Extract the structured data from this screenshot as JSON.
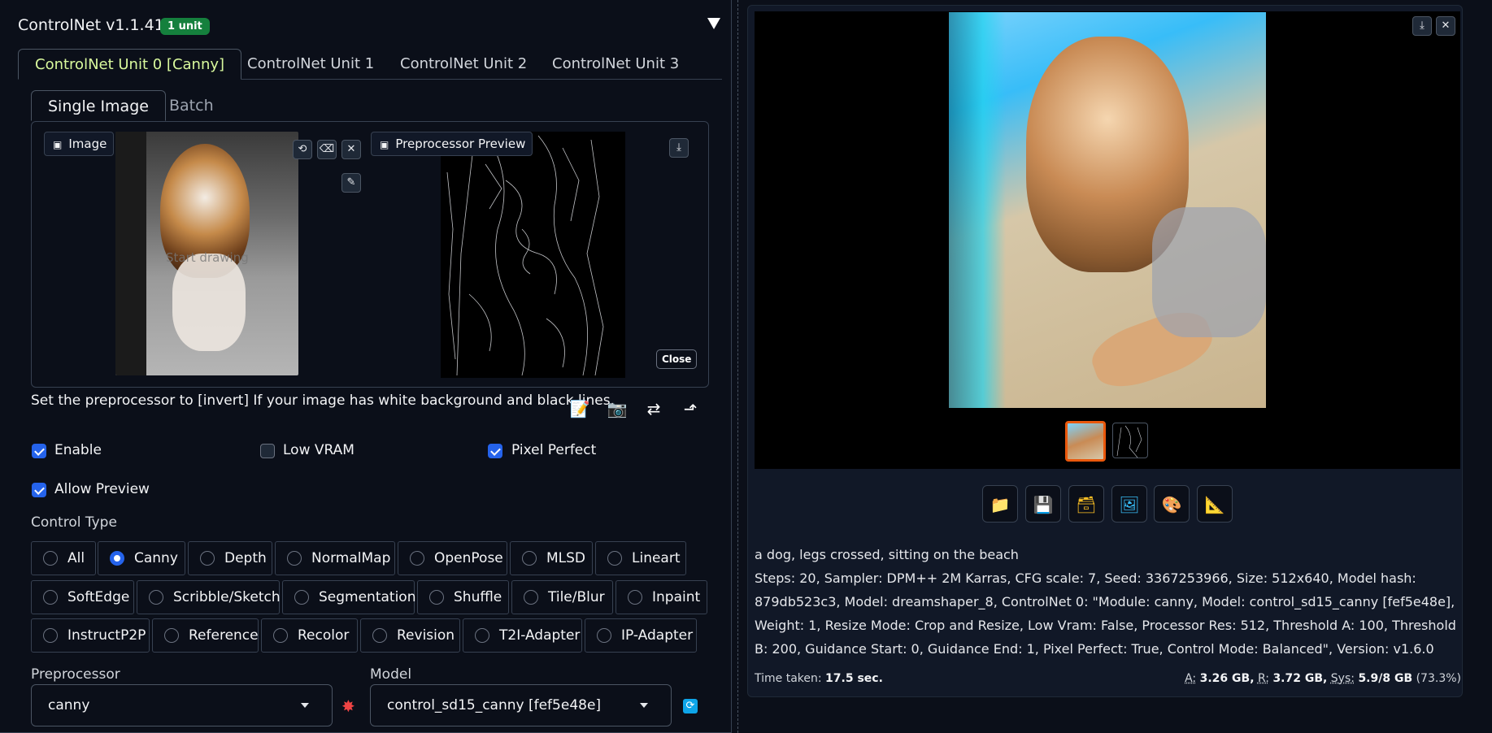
{
  "controlnet": {
    "title": "ControlNet v1.1.410",
    "units_badge": "1 unit",
    "unit_tabs": [
      "ControlNet Unit 0 [Canny]",
      "ControlNet Unit 1",
      "ControlNet Unit 2",
      "ControlNet Unit 3"
    ],
    "mode_tabs": [
      "Single Image",
      "Batch"
    ],
    "image_label": "Image",
    "preview_label": "Preprocessor Preview",
    "close_label": "Close",
    "overlay_text": "Start drawing",
    "note": "Set the preprocessor to [invert] If your image has white background and black lines.",
    "tool_icons": [
      "edit-icon",
      "camera-icon",
      "swap-icon",
      "send-dimensions-icon"
    ],
    "checkboxes": {
      "enable": {
        "label": "Enable",
        "checked": true
      },
      "low_vram": {
        "label": "Low VRAM",
        "checked": false
      },
      "pixel_perfect": {
        "label": "Pixel Perfect",
        "checked": true
      },
      "allow_preview": {
        "label": "Allow Preview",
        "checked": true
      }
    },
    "control_type_label": "Control Type",
    "control_types_row1": [
      "All",
      "Canny",
      "Depth",
      "NormalMap",
      "OpenPose",
      "MLSD",
      "Lineart"
    ],
    "control_types_row2": [
      "SoftEdge",
      "Scribble/Sketch",
      "Segmentation",
      "Shuffle",
      "Tile/Blur",
      "Inpaint"
    ],
    "control_types_row3": [
      "InstructP2P",
      "Reference",
      "Recolor",
      "Revision",
      "T2I-Adapter",
      "IP-Adapter"
    ],
    "selected_control_type": "Canny",
    "preprocessor_label": "Preprocessor",
    "preprocessor_value": "canny",
    "model_label": "Model",
    "model_value": "control_sd15_canny [fef5e48e]"
  },
  "output": {
    "prompt": "a dog, legs crossed, sitting on the beach",
    "params": "Steps: 20, Sampler: DPM++ 2M Karras, CFG scale: 7, Seed: 3367253966, Size: 512x640, Model hash: 879db523c3, Model: dreamshaper_8, ControlNet 0: \"Module: canny, Model: control_sd15_canny [fef5e48e], Weight: 1, Resize Mode: Crop and Resize, Low Vram: False, Processor Res: 512, Threshold A: 100, Threshold B: 200, Guidance Start: 0, Guidance End: 1, Pixel Perfect: True, Control Mode: Balanced\", Version: v1.6.0",
    "time_label": "Time taken:",
    "time_value": "17.5 sec.",
    "mem_a_label": "A:",
    "mem_a": "3.26 GB,",
    "mem_r_label": "R:",
    "mem_r": "3.72 GB,",
    "mem_sys_label": "Sys:",
    "mem_sys": "5.9/8 GB",
    "mem_pct": "(73.3%)",
    "action_icons": [
      "folder-icon",
      "save-icon",
      "zip-icon",
      "send-to-img2img-icon",
      "send-to-inpaint-icon",
      "send-to-extras-icon"
    ]
  }
}
